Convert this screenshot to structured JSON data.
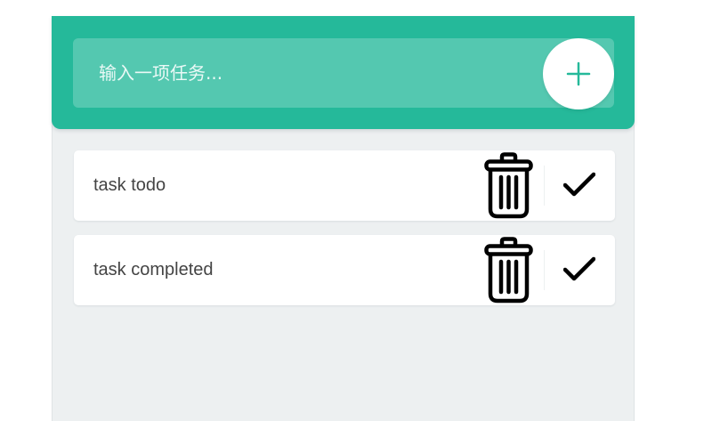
{
  "header": {
    "input_placeholder": "输入一项任务...",
    "add_button_icon": "plus-icon",
    "color": "#25b99a"
  },
  "todos": [
    {
      "text": "task todo",
      "remove_icon": "trash-icon",
      "complete_icon": "check-icon"
    },
    {
      "text": "task completed",
      "remove_icon": "trash-icon",
      "complete_icon": "check-icon"
    }
  ],
  "colors": {
    "accent": "#25b99a",
    "background": "#edf0f1",
    "text": "#444444",
    "icon": "#000000"
  }
}
